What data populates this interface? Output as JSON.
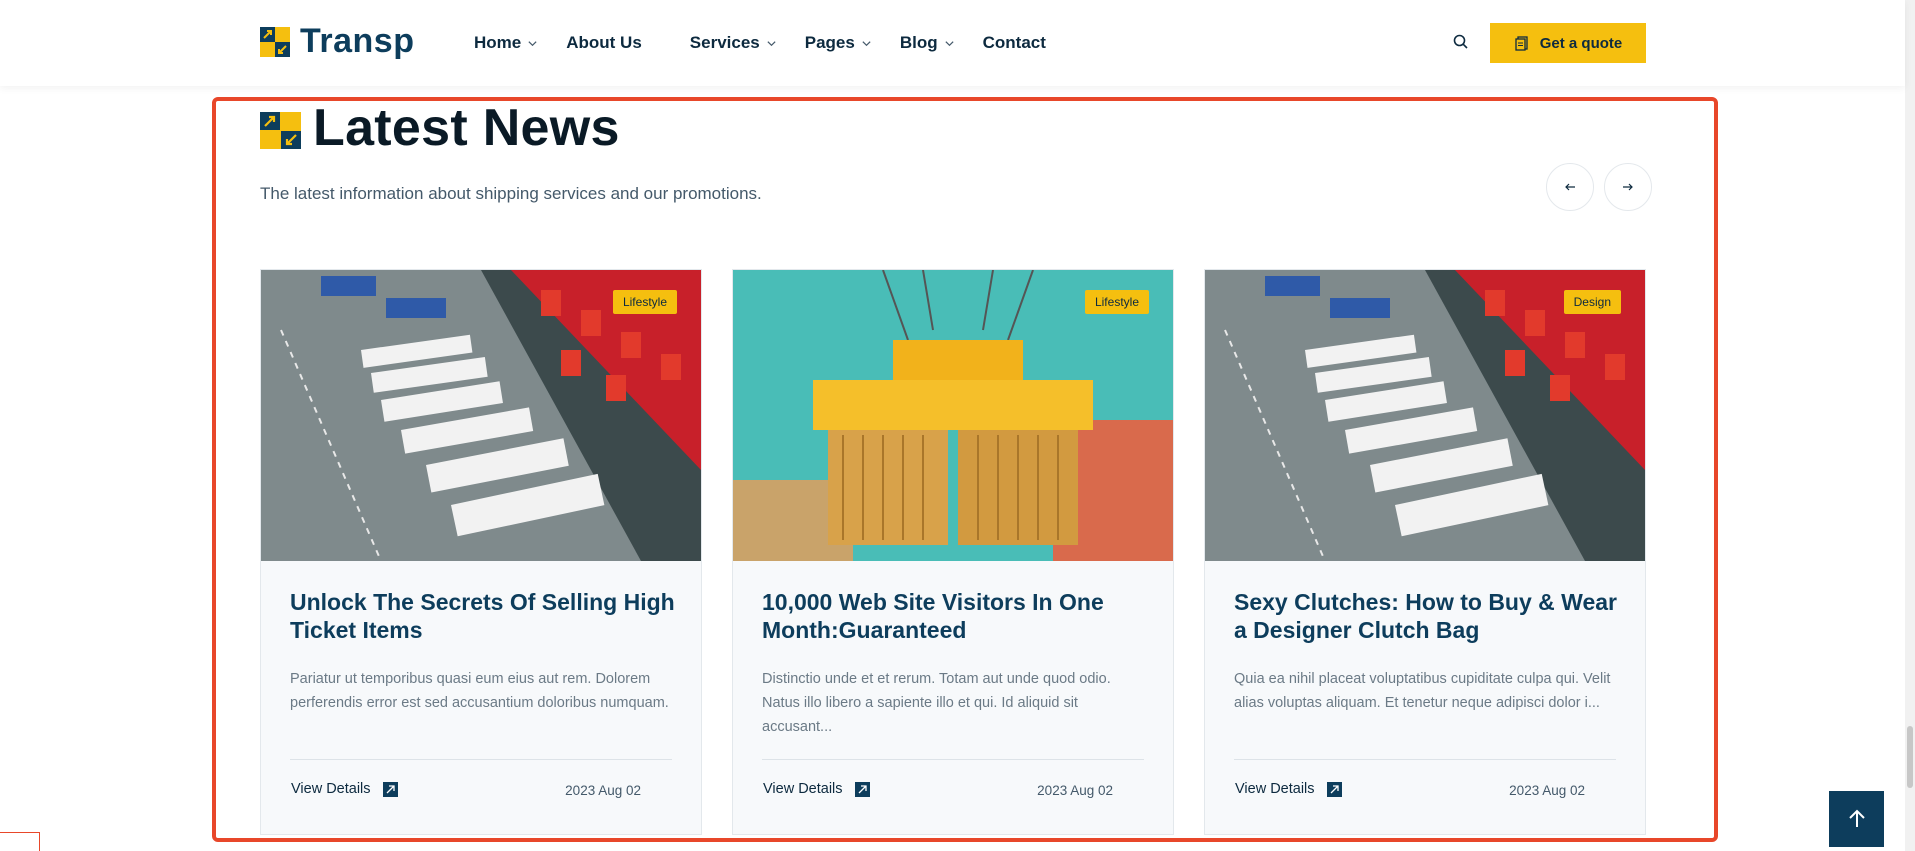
{
  "header": {
    "logo_text": "Transp",
    "nav": [
      {
        "label": "Home",
        "dropdown": true
      },
      {
        "label": "About Us",
        "dropdown": false
      },
      {
        "label": "Services",
        "dropdown": true
      },
      {
        "label": "Pages",
        "dropdown": true
      },
      {
        "label": "Blog",
        "dropdown": true
      },
      {
        "label": "Contact",
        "dropdown": false
      }
    ],
    "search_icon": "search-icon",
    "quote_button": "Get a quote"
  },
  "section": {
    "title": "Latest News",
    "subtitle": "The latest information about shipping services and our promotions.",
    "prev_icon": "arrow-left-icon",
    "next_icon": "arrow-right-icon"
  },
  "cards": [
    {
      "tag": "Lifestyle",
      "title": "Unlock The Secrets Of Selling High Ticket Items",
      "excerpt": "Pariatur ut temporibus quasi eum eius aut rem. Dolorem perferendis error est sed accusantium doloribus numquam.",
      "link": "View Details",
      "date": "2023 Aug 02",
      "image": "trucks-loading-dock"
    },
    {
      "tag": "Lifestyle",
      "title": "10,000 Web Site Visitors In One Month:Guaranteed",
      "excerpt": "Distinctio unde et et rerum. Totam aut unde quod odio. Natus illo libero a sapiente illo et qui. Id aliquid sit accusant...",
      "link": "View Details",
      "date": "2023 Aug 02",
      "image": "crane-lifting-containers"
    },
    {
      "tag": "Design",
      "title": "Sexy Clutches: How to Buy & Wear a Designer Clutch Bag",
      "excerpt": "Quia ea nihil placeat voluptatibus cupiditate culpa qui. Velit alias voluptas aliquam. Et tenetur neque adipisci dolor i...",
      "link": "View Details",
      "date": "2023 Aug 02",
      "image": "trucks-loading-dock"
    }
  ],
  "colors": {
    "accent": "#f5bf0f",
    "primary": "#0d3d5c",
    "highlight": "#e8472a"
  }
}
